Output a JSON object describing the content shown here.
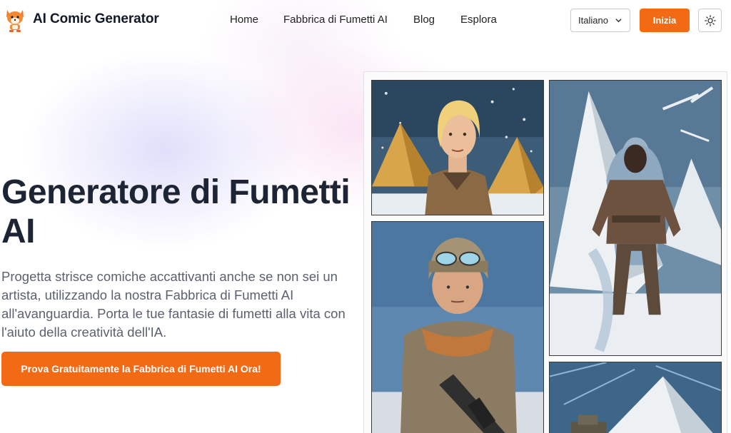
{
  "app": {
    "name": "AI Comic Generator",
    "logo_icon": "fox-mascot-icon"
  },
  "nav": {
    "items": [
      {
        "label": "Home"
      },
      {
        "label": "Fabbrica di Fumetti AI"
      },
      {
        "label": "Blog"
      },
      {
        "label": "Esplora"
      }
    ]
  },
  "header": {
    "language": {
      "selected": "Italiano"
    },
    "start_label": "Inizia",
    "theme_icon": "sun-icon"
  },
  "hero": {
    "title": "Generatore di Fumetti AI",
    "description": "Progetta strisce comiche accattivanti anche se non sei un artista, utilizzando la nostra Fabbrica di Fumetti AI all'avanguardia. Porta le tue fantasie di fumetti alla vita con l'aiuto della creatività dell'IA.",
    "cta_label": "Prova Gratuitamente la Fabbrica di Fumetti AI Ora!"
  },
  "colors": {
    "accent": "#f26a14",
    "title_text": "#1d2433",
    "body_text": "#5b6170"
  },
  "comic": {
    "panels": [
      {
        "subject": "woman explorer with pyramids"
      },
      {
        "subject": "warrior with pyramids in snow"
      },
      {
        "subject": "soldier with goggles and rifle"
      },
      {
        "subject": "pyramid with vehicle"
      }
    ]
  }
}
